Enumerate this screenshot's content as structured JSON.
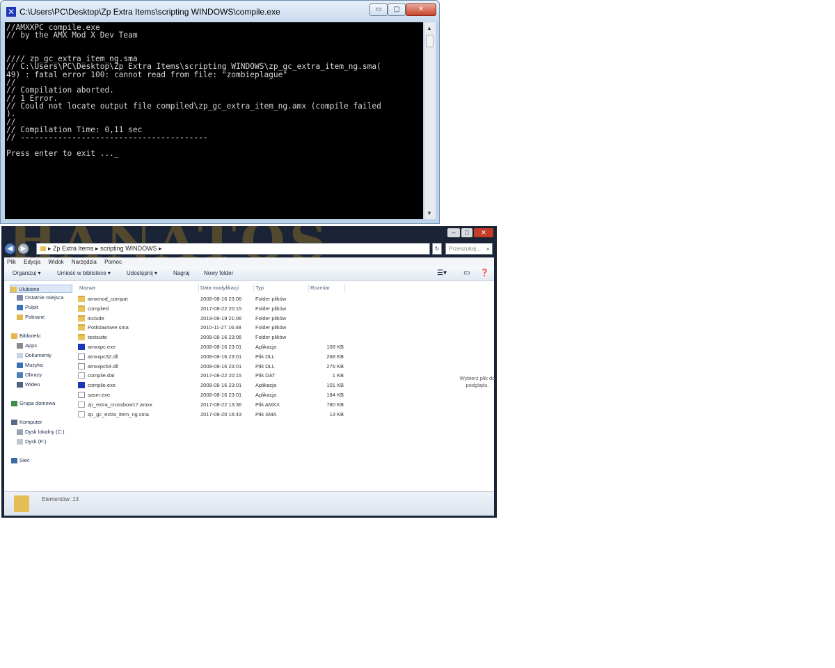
{
  "console": {
    "title": "C:\\Users\\PC\\Desktop\\Zp Extra Items\\scripting WINDOWS\\compile.exe",
    "lines": [
      "//AMXXPC compile.exe",
      "// by the AMX Mod X Dev Team",
      "",
      "",
      "//// zp_gc_extra_item_ng.sma",
      "// C:\\Users\\PC\\Desktop\\Zp Extra Items\\scripting WINDOWS\\zp_gc_extra_item_ng.sma(",
      "49) : fatal error 100: cannot read from file: \"zombieplague\"",
      "//",
      "// Compilation aborted.",
      "// 1 Error.",
      "// Could not locate output file compiled\\zp_gc_extra_item_ng.amx (compile failed",
      ").",
      "//",
      "// Compilation Time: 0,11 sec",
      "// ----------------------------------------",
      "",
      "Press enter to exit ..._"
    ],
    "buttons": {
      "minimize": "▭",
      "maximize": "▢",
      "close": "✕"
    }
  },
  "explorer": {
    "background_text": "HANATOS",
    "window_buttons": {
      "minimize": "–",
      "maximize": "□",
      "close": "✕"
    },
    "breadcrumb": [
      "Zp Extra Items",
      "scripting WINDOWS"
    ],
    "search_placeholder": "Przeszukaj...",
    "menu": [
      "Plik",
      "Edycja",
      "Widok",
      "Narzędzia",
      "Pomoc"
    ],
    "toolbar": [
      "Organizuj ▾",
      "Umieść w bibliotece ▾",
      "Udostępnij ▾",
      "Nagraj",
      "Nowy folder"
    ],
    "nav": {
      "favorites": [
        "Ulubione",
        "Ostatnie miejsca",
        "Pulpit",
        "Pobrane"
      ],
      "libraries": [
        "Biblioteki",
        "Apps",
        "Dokumenty",
        "Muzyka",
        "Obrazy",
        "Wideo"
      ],
      "homegroup": "Grupa domowa",
      "computer": [
        "Komputer",
        "Dysk lokalny (C:)",
        "Dysk (F:)"
      ],
      "network": "Sieć"
    },
    "columns": [
      "Nazwa",
      "Data modyfikacji",
      "Typ",
      "Rozmiar"
    ],
    "files": [
      {
        "name": "amxmod_compat",
        "date": "2008-08-16 23:06",
        "type": "Folder plików",
        "size": "",
        "kind": "folder"
      },
      {
        "name": "compiled",
        "date": "2017-08-22 20:15",
        "type": "Folder plików",
        "size": "",
        "kind": "folder"
      },
      {
        "name": "include",
        "date": "2019-08-19 21:06",
        "type": "Folder plików",
        "size": "",
        "kind": "folder"
      },
      {
        "name": "Podstawowe sma",
        "date": "2010-11-27 16:48",
        "type": "Folder plików",
        "size": "",
        "kind": "folder"
      },
      {
        "name": "testsuite",
        "date": "2008-08-16 23:06",
        "type": "Folder plików",
        "size": "",
        "kind": "folder"
      },
      {
        "name": "amxxpc.exe",
        "date": "2008-08-16 23:01",
        "type": "Aplikacja",
        "size": "108 KB",
        "kind": "exe"
      },
      {
        "name": "amxxpc32.dll",
        "date": "2008-08-16 23:01",
        "type": "Plik DLL",
        "size": "268 KB",
        "kind": "dll"
      },
      {
        "name": "amxxpc64.dll",
        "date": "2008-08-16 23:01",
        "type": "Plik DLL",
        "size": "276 KB",
        "kind": "dll"
      },
      {
        "name": "compile.dat",
        "date": "2017-08-22 20:15",
        "type": "Plik DAT",
        "size": "1 KB",
        "kind": "file"
      },
      {
        "name": "compile.exe",
        "date": "2008-08-16 23:01",
        "type": "Aplikacja",
        "size": "101 KB",
        "kind": "exe"
      },
      {
        "name": "sasm.exe",
        "date": "2008-08-16 23:01",
        "type": "Aplikacja",
        "size": "184 KB",
        "kind": "dll"
      },
      {
        "name": "zp_extra_crossbow17.amxx",
        "date": "2017-08-22 13:36",
        "type": "Plik AMXX",
        "size": "780 KB",
        "kind": "file"
      },
      {
        "name": "zp_gc_extra_item_ng.sma",
        "date": "2017-08-20 16:43",
        "type": "Plik SMA",
        "size": "13 KB",
        "kind": "file"
      }
    ],
    "preview_text": "Wybierz plik do podglądu.",
    "status_count": "Elementów: 13"
  }
}
